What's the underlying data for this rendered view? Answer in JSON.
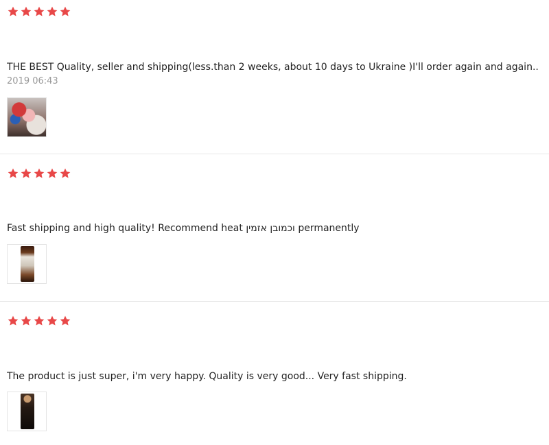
{
  "accent_color": "#e84848",
  "star_icon": "star-icon",
  "reviews": [
    {
      "rating": 5,
      "text": "THE BEST Quality, seller and shipping(less.than 2 weeks, about 10 days to Ukraine )I'll order again and again..",
      "date": "2019 06:43",
      "photo_count": 1
    },
    {
      "rating": 5,
      "text": "Fast shipping and high quality! Recommend heat וכמובן אזמין permanently",
      "photo_count": 1
    },
    {
      "rating": 5,
      "text": "The product is just super, i'm very happy. Quality is very good... Very fast shipping.",
      "photo_count": 1
    }
  ]
}
